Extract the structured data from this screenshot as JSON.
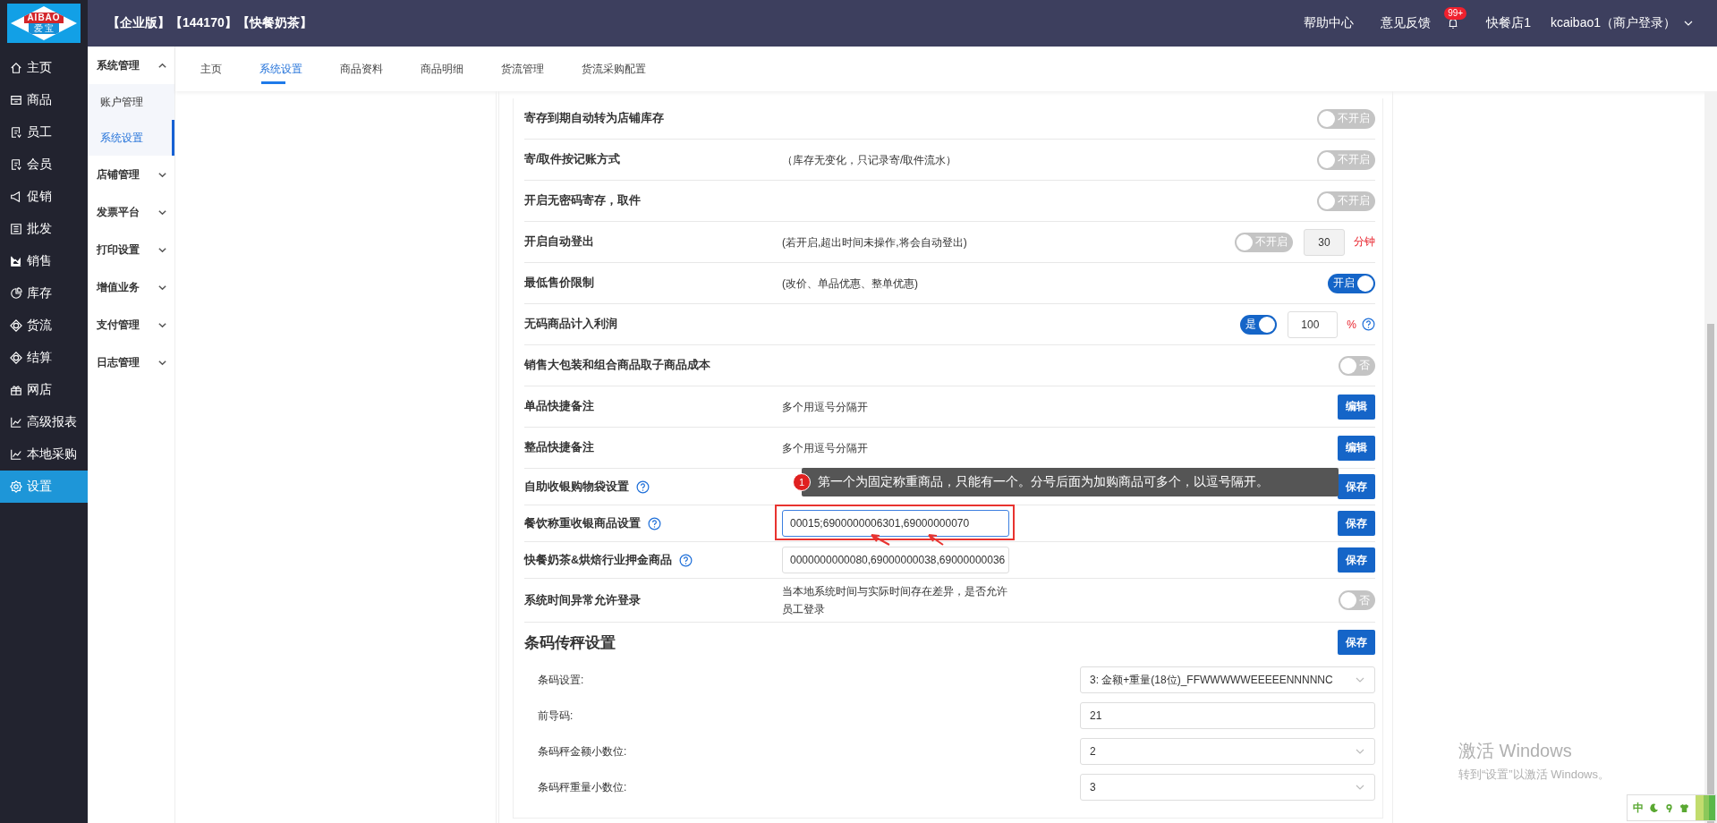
{
  "logo": {
    "top": "AIBAO",
    "bottom": "爱 宝"
  },
  "header": {
    "title": "【企业版】【144170】【快餐奶茶】",
    "links": [
      "帮助中心",
      "意见反馈"
    ],
    "notification_badge": "99+",
    "store": "快餐店1",
    "user": "kcaibao1（商户登录）"
  },
  "sidebar": {
    "items": [
      {
        "label": "主页",
        "selected": false
      },
      {
        "label": "商品",
        "selected": false
      },
      {
        "label": "员工",
        "selected": false
      },
      {
        "label": "会员",
        "selected": false
      },
      {
        "label": "促销",
        "selected": false
      },
      {
        "label": "批发",
        "selected": false
      },
      {
        "label": "销售",
        "selected": false
      },
      {
        "label": "库存",
        "selected": false
      },
      {
        "label": "货流",
        "selected": false
      },
      {
        "label": "结算",
        "selected": false
      },
      {
        "label": "网店",
        "selected": false
      },
      {
        "label": "高级报表",
        "selected": false
      },
      {
        "label": "本地采购",
        "selected": false
      },
      {
        "label": "设置",
        "selected": true
      }
    ]
  },
  "subnav": {
    "groups": [
      {
        "label": "系统管理",
        "expanded": true,
        "children": [
          {
            "label": "账户管理",
            "selected": false
          },
          {
            "label": "系统设置",
            "selected": true
          }
        ]
      },
      {
        "label": "店铺管理",
        "expanded": false
      },
      {
        "label": "发票平台",
        "expanded": false
      },
      {
        "label": "打印设置",
        "expanded": false
      },
      {
        "label": "增值业务",
        "expanded": false
      },
      {
        "label": "支付管理",
        "expanded": false
      },
      {
        "label": "日志管理",
        "expanded": false
      }
    ]
  },
  "tabs": [
    {
      "label": "主页",
      "selected": false
    },
    {
      "label": "系统设置",
      "selected": true
    },
    {
      "label": "商品资料",
      "selected": false
    },
    {
      "label": "商品明细",
      "selected": false
    },
    {
      "label": "货流管理",
      "selected": false
    },
    {
      "label": "货流采购配置",
      "selected": false
    }
  ],
  "settings": [
    {
      "kind": "switch",
      "label": "寄存到期自动转为店铺库存",
      "switch": {
        "on": false,
        "label": "不开启"
      }
    },
    {
      "kind": "switch",
      "label": "寄/取件按记账方式",
      "description": "（库存无变化，只记录寄/取件流水）",
      "switch": {
        "on": false,
        "label": "不开启"
      }
    },
    {
      "kind": "switch",
      "label": "开启无密码寄存，取件",
      "switch": {
        "on": false,
        "label": "不开启"
      }
    },
    {
      "kind": "switch",
      "label": "开启自动登出",
      "description": "(若开启,超出时间未操作,将会自动登出)",
      "switch": {
        "on": false,
        "label": "不开启"
      },
      "input": {
        "value": "30",
        "disabled": true
      },
      "unit": "分钟"
    },
    {
      "kind": "switch",
      "label": "最低售价限制",
      "description": "(改价、单品优惠、整单优惠)",
      "switch": {
        "on": true,
        "label": "开启"
      }
    },
    {
      "kind": "switch",
      "label": "无码商品计入利润",
      "switch": {
        "on": true,
        "label": "是"
      },
      "input": {
        "value": "100",
        "disabled": false
      },
      "unit": "%",
      "unit_help": true
    },
    {
      "kind": "switch",
      "label": "销售大包装和组合商品取子商品成本",
      "switch": {
        "on": false,
        "label": "否"
      }
    },
    {
      "kind": "button",
      "label": "单品快捷备注",
      "description": "多个用逗号分隔开",
      "button": "编辑"
    },
    {
      "kind": "button",
      "label": "整品快捷备注",
      "description": "多个用逗号分隔开",
      "button": "编辑"
    },
    {
      "kind": "field",
      "label": "自助收银购物袋设置",
      "help": true,
      "button": "保存"
    },
    {
      "kind": "field",
      "label": "餐饮称重收银商品设置",
      "help": true,
      "value": "00015;6900000006301,69000000070",
      "highlighted": true,
      "button": "保存"
    },
    {
      "kind": "field",
      "label": "快餐奶茶&烘焙行业押金商品",
      "help": true,
      "value": "0000000000080,69000000038,69000000036",
      "highlighted": false,
      "button": "保存"
    },
    {
      "kind": "switch",
      "label": "系统时间异常允许登录",
      "description": "当本地系统时间与实际时间存在差异，是否允许员工登录",
      "switch": {
        "on": false,
        "label": "否"
      }
    }
  ],
  "annotation": {
    "badge": "1",
    "text": "第一个为固定称重商品，只能有一个。分号后面为加购商品可多个，以逗号隔开。"
  },
  "barcode_section": {
    "title": "条码传秤设置",
    "button": "保存",
    "fields": [
      {
        "kind": "select",
        "label": "条码设置:",
        "value": "3: 金额+重量(18位)_FFWWWWWEEEEENNNNNC"
      },
      {
        "kind": "input",
        "label": "前导码:",
        "value": "21"
      },
      {
        "kind": "select",
        "label": "条码秤金额小数位:",
        "value": "2"
      },
      {
        "kind": "select",
        "label": "条码秤重量小数位:",
        "value": "3"
      }
    ]
  },
  "windows_activation": {
    "title": "激活 Windows",
    "subtitle": "转到“设置”以激活 Windows。"
  },
  "ime_bar": {
    "mode": "中"
  }
}
